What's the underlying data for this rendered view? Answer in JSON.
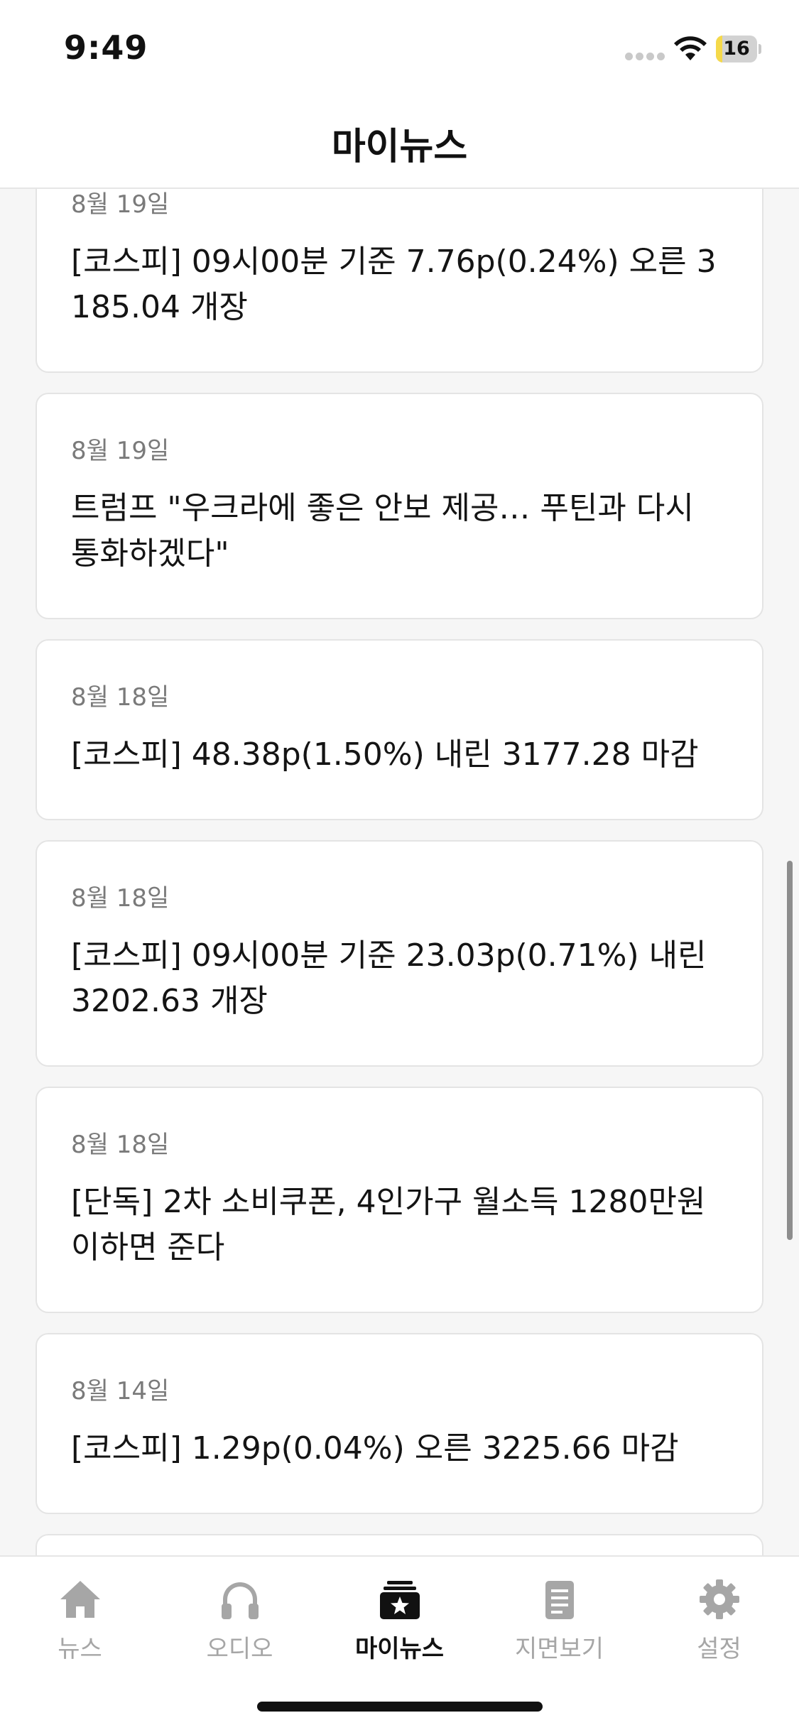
{
  "status_bar": {
    "time": "9:49",
    "battery_level": "16",
    "battery_fraction": 0.16,
    "wifi_icon": "wifi-icon",
    "signal_icon": "cellular-dots-icon"
  },
  "header": {
    "title": "마이뉴스"
  },
  "feed": {
    "items": [
      {
        "date": "8월 19일",
        "title": "[코스피] 09시00분 기준 7.76p(0.24%) 오른 3185.04 개장"
      },
      {
        "date": "8월 19일",
        "title": "트럼프 \"우크라에 좋은 안보 제공… 푸틴과 다시 통화하겠다\""
      },
      {
        "date": "8월 18일",
        "title": "[코스피] 48.38p(1.50%) 내린 3177.28 마감"
      },
      {
        "date": "8월 18일",
        "title": "[코스피] 09시00분 기준 23.03p(0.71%) 내린 3202.63 개장"
      },
      {
        "date": "8월 18일",
        "title": "[단독] 2차 소비쿠폰, 4인가구 월소득 1280만원 이하면 준다"
      },
      {
        "date": "8월 14일",
        "title": "[코스피] 1.29p(0.04%) 오른 3225.66 마감"
      },
      {
        "date": "",
        "title": ""
      }
    ]
  },
  "tab_bar": {
    "tabs": [
      {
        "label": "뉴스",
        "icon": "home-icon",
        "active": false
      },
      {
        "label": "오디오",
        "icon": "headphones-icon",
        "active": false
      },
      {
        "label": "마이뉴스",
        "icon": "star-archive-icon",
        "active": true
      },
      {
        "label": "지면보기",
        "icon": "document-icon",
        "active": false
      },
      {
        "label": "설정",
        "icon": "gear-icon",
        "active": false
      }
    ]
  },
  "colors": {
    "background": "#f6f6f6",
    "card": "#ffffff",
    "text": "#141414",
    "date_text": "#7a7a7a",
    "tab_inactive": "#a6a6a6",
    "tab_active": "#111111",
    "battery_fill": "#f5d94a"
  }
}
